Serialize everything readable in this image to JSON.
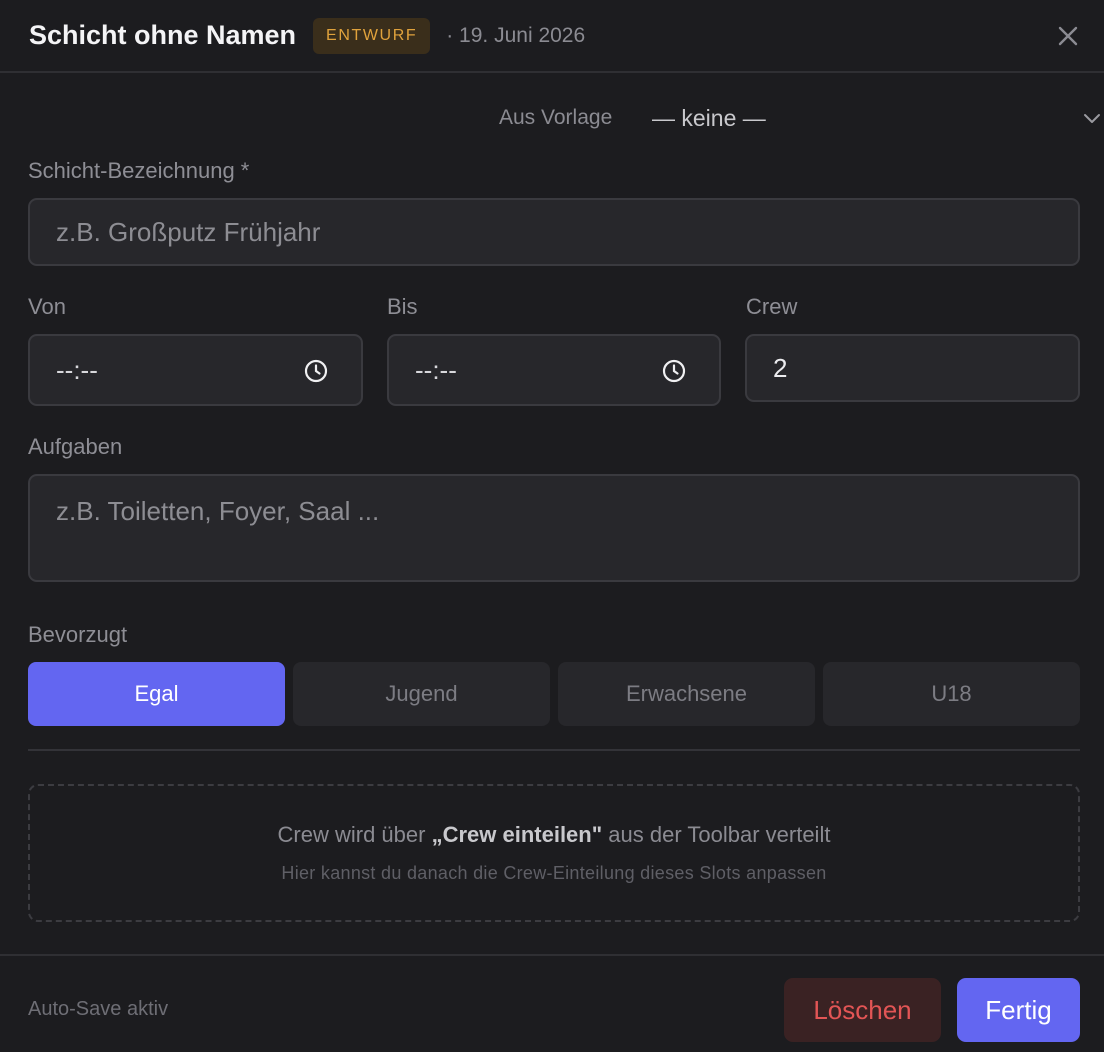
{
  "header": {
    "title": "Schicht ohne Namen",
    "badge": "ENTWURF",
    "date": "· 19. Juni 2026"
  },
  "template": {
    "label": "Aus Vorlage",
    "value": "— keine —"
  },
  "form": {
    "name_label": "Schicht-Bezeichnung *",
    "name_placeholder": "z.B. Großputz Frühjahr",
    "from_label": "Von",
    "from_value": "--:--",
    "to_label": "Bis",
    "to_value": "--:--",
    "crew_label": "Crew",
    "crew_value": "2",
    "tasks_label": "Aufgaben",
    "tasks_placeholder": "z.B. Toiletten, Foyer, Saal ..."
  },
  "preference": {
    "label": "Bevorzugt",
    "options": [
      "Egal",
      "Jugend",
      "Erwachsene",
      "U18"
    ],
    "selected": "Egal"
  },
  "info": {
    "main_prefix": "Crew wird über ",
    "main_strong": "„Crew einteilen\"",
    "main_suffix": " aus der Toolbar verteilt",
    "sub": "Hier kannst du danach die Crew-Einteilung dieses Slots anpassen"
  },
  "footer": {
    "autosave": "Auto-Save aktiv",
    "delete_label": "Löschen",
    "done_label": "Fertig"
  },
  "colors": {
    "accent": "#6366f1",
    "badge_text": "#e0a23c",
    "danger": "#e25555",
    "background": "#1c1c1f"
  }
}
